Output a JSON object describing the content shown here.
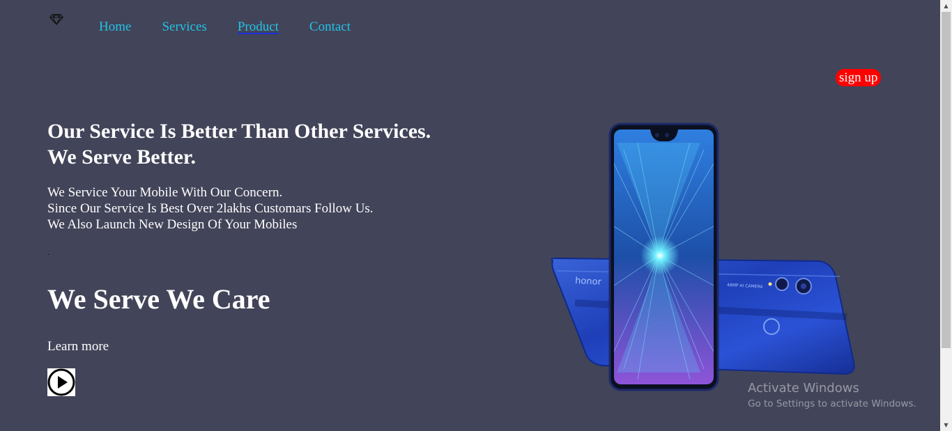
{
  "logo": {
    "icon": "diamond-icon"
  },
  "nav": {
    "items": [
      {
        "label": "Home"
      },
      {
        "label": "Services"
      },
      {
        "label": "Product"
      },
      {
        "label": "Contact"
      }
    ]
  },
  "signup": {
    "label": "sign up"
  },
  "hero": {
    "headline_line1": "Our Service Is Better Than Other Services.",
    "headline_line2": "We Serve Better.",
    "sub_line1": "We Service Your Mobile With Our Concern.",
    "sub_line2": "Since Our Service Is Best Over 2lakhs Customars Follow Us.",
    "sub_line3": "We Also Launch New Design Of Your Mobiles",
    "dot": ".",
    "tagline": "We Serve We Care",
    "learn_more": "Learn more",
    "play_icon": "play-circle-icon"
  },
  "phone": {
    "brand": "honor",
    "camera_text": "48MP AI CAMERA"
  },
  "watermark": {
    "title": "Activate Windows",
    "subtitle": "Go to Settings to activate Windows."
  },
  "colors": {
    "background": "#424459",
    "nav_link": "#22c3e6",
    "signup_bg": "#ff0000",
    "text": "#ffffff"
  }
}
